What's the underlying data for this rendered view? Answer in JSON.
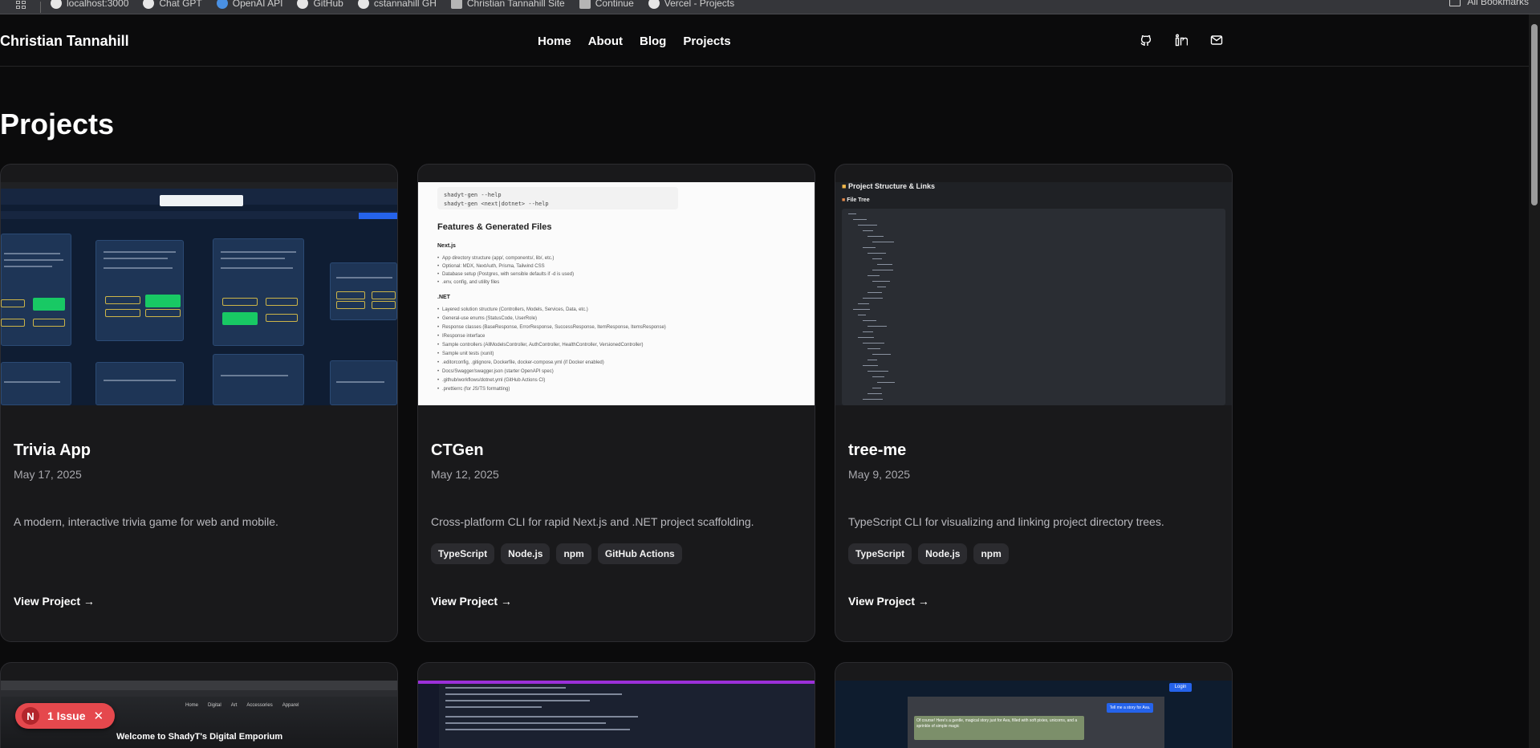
{
  "bookmarks": {
    "items": [
      {
        "label": "localhost:3000",
        "icon": "github-icon"
      },
      {
        "label": "Chat GPT",
        "icon": "openai-icon"
      },
      {
        "label": "OpenAI API",
        "icon": "openai-icon"
      },
      {
        "label": "GitHub",
        "icon": "github-icon"
      },
      {
        "label": "cstannahill GH",
        "icon": "github-icon"
      },
      {
        "label": "Christian Tannahill Site",
        "icon": "page-icon"
      },
      {
        "label": "Continue",
        "icon": "page-icon"
      },
      {
        "label": "Vercel - Projects",
        "icon": "vercel-icon"
      }
    ],
    "all_bookmarks": "All Bookmarks"
  },
  "header": {
    "brand": "Christian Tannahill",
    "nav": [
      "Home",
      "About",
      "Blog",
      "Projects"
    ],
    "social": [
      "github-icon",
      "linkedin-icon",
      "mail-icon"
    ]
  },
  "page": {
    "title": "Projects"
  },
  "projects": [
    {
      "title": "Trivia App",
      "date": "May 17, 2025",
      "description": "A modern, interactive trivia game for web and mobile.",
      "tags": [],
      "link": "View Project →"
    },
    {
      "title": "CTGen",
      "date": "May 12, 2025",
      "description": "Cross-platform CLI for rapid Next.js and .NET project scaffolding.",
      "tags": [
        "TypeScript",
        "Node.js",
        "npm",
        "GitHub Actions"
      ],
      "link": "View Project →"
    },
    {
      "title": "tree-me",
      "date": "May 9, 2025",
      "description": "TypeScript CLI for visualizing and linking project directory trees.",
      "tags": [
        "TypeScript",
        "Node.js",
        "npm"
      ],
      "link": "View Project →"
    }
  ],
  "ctgen_preview": {
    "code": [
      "shadyt-gen --help",
      "shadyt-gen <next|dotnet> --help"
    ],
    "heading": "Features & Generated Files",
    "section_next": "Next.js",
    "next_items": [
      "App directory structure (app/, components/, lib/, etc.)",
      "Optional: MDX, NextAuth, Prisma, Tailwind CSS",
      "Database setup (Postgres, with sensible defaults if -d is used)",
      ".env, config, and utility files"
    ],
    "section_net": ".NET",
    "net_items": [
      "Layered solution structure (Controllers, Models, Services, Data, etc.)",
      "General-use enums (StatusCode, UserRole)",
      "Response classes (BaseResponse, ErrorResponse, SuccessResponse, ItemResponse, ItemsResponse)",
      "IResponse interface",
      "Sample controllers (AllModelsController, AuthController, HealthController, VersionedController)",
      "Sample unit tests (xunit)",
      ".editorconfig, .gitignore, Dockerfile, docker-compose.yml (if Docker enabled)",
      "Docs/Swagger/swagger.json (starter OpenAPI spec)",
      ".github/workflows/dotnet.yml (GitHub Actions CI)",
      ".prettierrc (for JS/TS formatting)"
    ]
  },
  "tree_preview": {
    "title": "Project Structure & Links",
    "subtitle": "File Tree"
  },
  "bottom_previews": {
    "shop_heading": "Welcome to ShadyT's Digital Emporium",
    "shop_nav": [
      "Home",
      "Digital",
      "Art",
      "Accessories",
      "Apparel"
    ],
    "chat_bubble": "Of course! Here's a gentle, magical story just for Ava, filled with soft pixies, unicorns, and a sprinkle of simple magic",
    "chat_button": "Tell me a story for Ava.",
    "login": "Login"
  },
  "issue_badge": {
    "avatar": "N",
    "label": "1 Issue"
  },
  "colors": {
    "background": "#0b0b0c",
    "card": "#19191b",
    "accent_green": "#18c964",
    "issue_red": "#e5484d"
  }
}
